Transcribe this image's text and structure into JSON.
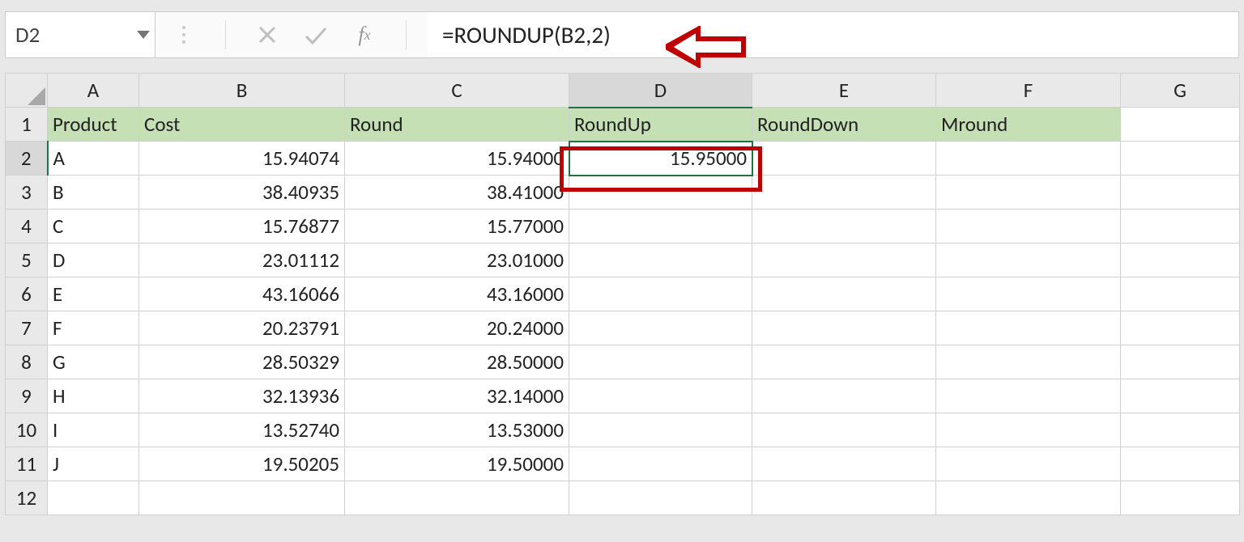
{
  "formula_bar": {
    "cell_ref": "D2",
    "formula": "=ROUNDUP(B2,2)"
  },
  "columns": [
    "A",
    "B",
    "C",
    "D",
    "E",
    "F",
    "G"
  ],
  "active_column": "D",
  "active_row": "2",
  "headers": {
    "A": "Product",
    "B": "Cost",
    "C": "Round",
    "D": "RoundUp",
    "E": "RoundDown",
    "F": "Mround"
  },
  "rows": [
    {
      "n": "2",
      "A": "A",
      "B": "15.94074",
      "C": "15.94000",
      "D": "15.95000",
      "E": "",
      "F": ""
    },
    {
      "n": "3",
      "A": "B",
      "B": "38.40935",
      "C": "38.41000",
      "D": "",
      "E": "",
      "F": ""
    },
    {
      "n": "4",
      "A": "C",
      "B": "15.76877",
      "C": "15.77000",
      "D": "",
      "E": "",
      "F": ""
    },
    {
      "n": "5",
      "A": "D",
      "B": "23.01112",
      "C": "23.01000",
      "D": "",
      "E": "",
      "F": ""
    },
    {
      "n": "6",
      "A": "E",
      "B": "43.16066",
      "C": "43.16000",
      "D": "",
      "E": "",
      "F": ""
    },
    {
      "n": "7",
      "A": "F",
      "B": "20.23791",
      "C": "20.24000",
      "D": "",
      "E": "",
      "F": ""
    },
    {
      "n": "8",
      "A": "G",
      "B": "28.50329",
      "C": "28.50000",
      "D": "",
      "E": "",
      "F": ""
    },
    {
      "n": "9",
      "A": "H",
      "B": "32.13936",
      "C": "32.14000",
      "D": "",
      "E": "",
      "F": ""
    },
    {
      "n": "10",
      "A": "I",
      "B": "13.52740",
      "C": "13.53000",
      "D": "",
      "E": "",
      "F": ""
    },
    {
      "n": "11",
      "A": "J",
      "B": "19.50205",
      "C": "19.50000",
      "D": "",
      "E": "",
      "F": ""
    }
  ],
  "empty_rows": [
    "12"
  ]
}
